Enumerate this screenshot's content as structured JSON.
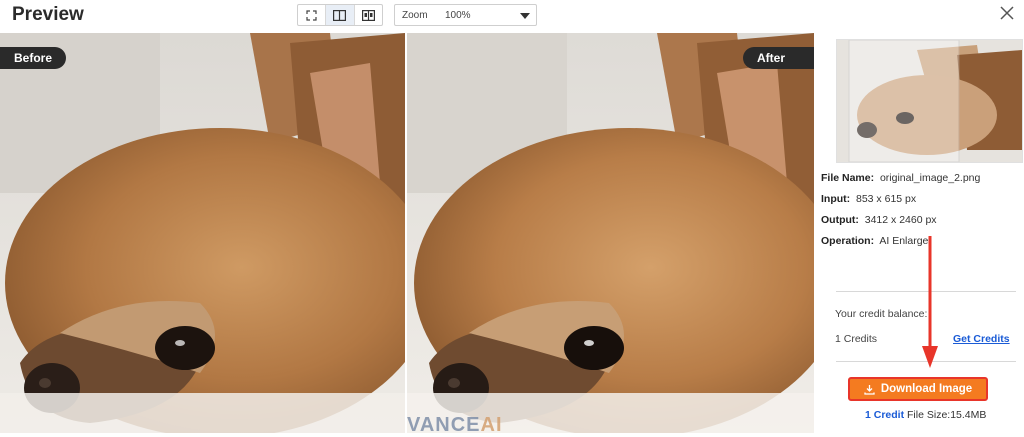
{
  "header": {
    "title": "Preview",
    "zoom_label": "Zoom",
    "zoom_value": "100%"
  },
  "view_modes": [
    "fit-icon",
    "split-view-icon",
    "compare-view-icon"
  ],
  "images": {
    "before_label": "Before",
    "after_label": "After",
    "watermark_main": "VANCE",
    "watermark_ai": "AI"
  },
  "details": {
    "file_name_label": "File Name:",
    "file_name": "original_image_2.png",
    "input_label": "Input:",
    "input": "853 x 615 px",
    "output_label": "Output:",
    "output": "3412 x 2460 px",
    "operation_label": "Operation:",
    "operation": "AI Enlarge"
  },
  "credits": {
    "balance_label": "Your credit balance:",
    "count": "1 Credits",
    "get_credits": "Get Credits"
  },
  "download": {
    "label": "Download Image",
    "cost": "1 Credit",
    "file_size": "File Size:15.4MB"
  },
  "colors": {
    "accent": "#f47b20",
    "highlight_border": "#e8352a",
    "link": "#1a5bd6"
  }
}
